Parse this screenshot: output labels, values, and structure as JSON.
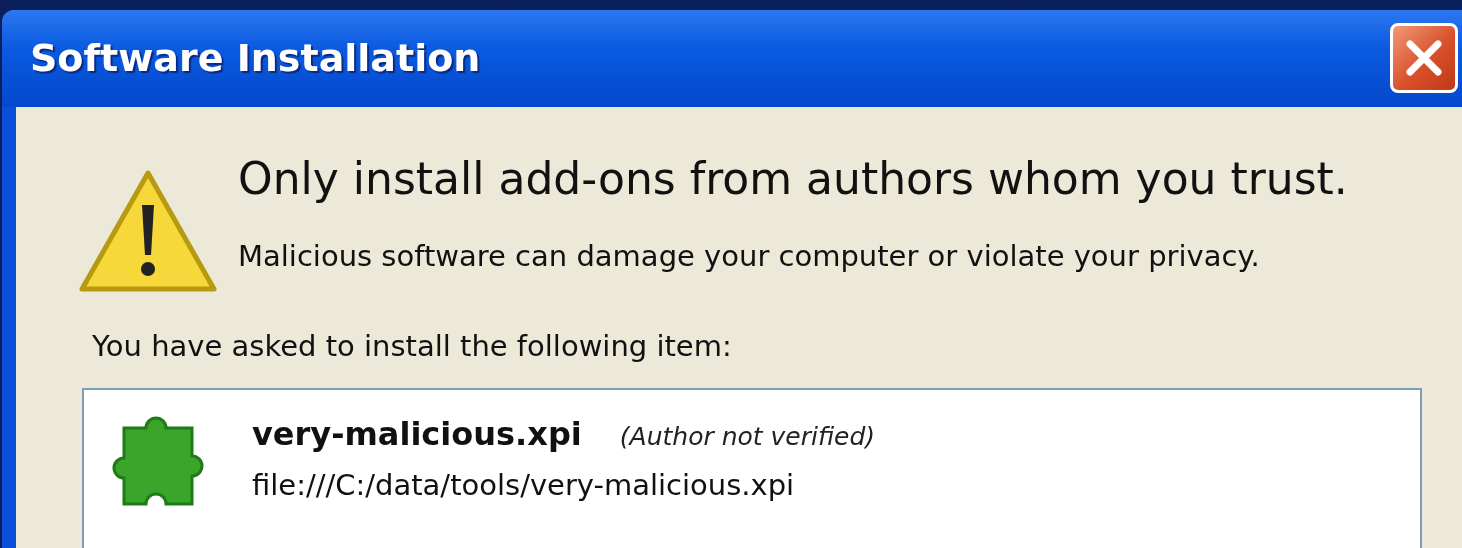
{
  "window": {
    "title": "Software Installation"
  },
  "heading": "Only install add-ons from authors whom you trust.",
  "warning": "Malicious software can damage your computer or violate your privacy.",
  "prompt": "You have asked to install the following item:",
  "items": [
    {
      "name": "very-malicious.xpi",
      "note": "(Author not verified)",
      "url": "file:///C:/data/tools/very-malicious.xpi"
    }
  ]
}
